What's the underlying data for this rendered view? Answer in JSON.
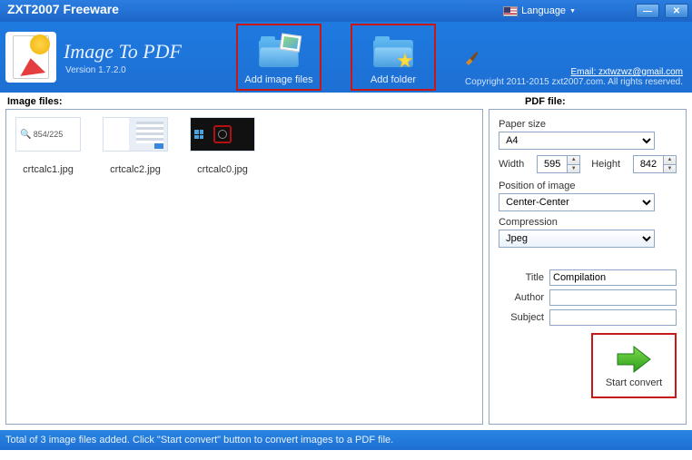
{
  "titlebar": {
    "title": "ZXT2007 Freeware",
    "language_label": "Language"
  },
  "header": {
    "app_title": "Image To PDF",
    "version": "Version 1.7.2.0",
    "add_image": "Add image files",
    "add_folder": "Add folder",
    "email": "Email: zxtwzwz@gmail.com",
    "copyright": "Copyright  2011-2015 zxt2007.com.  All rights reserved."
  },
  "labels": {
    "image_files": "Image files:",
    "pdf_file": "PDF file:"
  },
  "files": [
    {
      "name": "crtcalc1.jpg",
      "preview_text": "854/225"
    },
    {
      "name": "crtcalc2.jpg",
      "preview_text": ""
    },
    {
      "name": "crtcalc0.jpg",
      "preview_text": ""
    }
  ],
  "pdf": {
    "paper_size_label": "Paper size",
    "paper_size_value": "A4",
    "width_label": "Width",
    "width_value": "595",
    "height_label": "Height",
    "height_value": "842",
    "position_label": "Position of image",
    "position_value": "Center-Center",
    "compression_label": "Compression",
    "compression_value": "Jpeg",
    "title_label": "Title",
    "title_value": "Compilation",
    "author_label": "Author",
    "author_value": "",
    "subject_label": "Subject",
    "subject_value": "",
    "start_convert": "Start convert"
  },
  "status": "Total of 3 image files added. Click \"Start convert\" button to convert images to a PDF file."
}
